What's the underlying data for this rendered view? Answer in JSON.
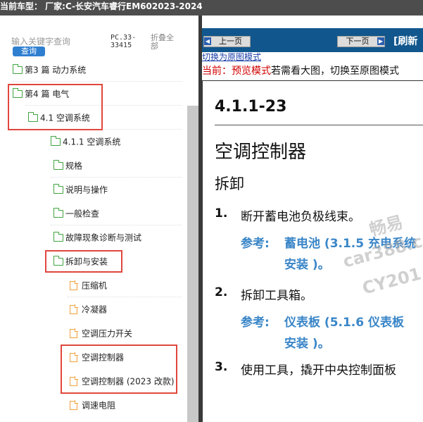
{
  "top_bar": {
    "text": "当前车型： 厂家:C-长安汽车睿行EM602023-2024"
  },
  "sidebar": {
    "search_placeholder": "输入关键字查询",
    "search_button": "查询",
    "pc_code": "PC.33-33415",
    "collapse_all": "折叠全部",
    "items": [
      {
        "label": "第3 篇 动力系统",
        "icon": "folder-icon"
      },
      {
        "label": "第4 篇 电气",
        "icon": "folder-icon"
      },
      {
        "label": "4.1 空调系统",
        "icon": "folder-icon"
      },
      {
        "label": "4.1.1 空调系统",
        "icon": "folder-icon"
      },
      {
        "label": "规格",
        "icon": "folder-icon"
      },
      {
        "label": "说明与操作",
        "icon": "folder-icon"
      },
      {
        "label": "一般检查",
        "icon": "folder-icon"
      },
      {
        "label": "故障现象诊断与测试",
        "icon": "folder-icon"
      },
      {
        "label": "拆卸与安装",
        "icon": "folder-icon"
      },
      {
        "label": "压缩机",
        "icon": "document-icon"
      },
      {
        "label": "冷凝器",
        "icon": "document-icon"
      },
      {
        "label": "空调压力开关",
        "icon": "document-icon"
      },
      {
        "label": "空调控制器",
        "icon": "document-icon"
      },
      {
        "label": "空调控制器 (2023 改款)",
        "icon": "document-icon"
      },
      {
        "label": "调速电阻",
        "icon": "document-icon"
      }
    ]
  },
  "viewer": {
    "prev_button": "上一页",
    "next_button": "下一页",
    "refresh_link": "[刷新",
    "origin_link": "切换为原图模式",
    "preview_prefix": "当前：",
    "preview_mode": "预览模式",
    "preview_hint": "若需看大图，切换至原图模式",
    "accent_color": "#11578d",
    "highlight_color": "#e0473d"
  },
  "document": {
    "section_number": "4.1.1-23",
    "title": "空调控制器",
    "subtitle": "拆卸",
    "ref_label": "参考:",
    "steps": [
      {
        "num": "1.",
        "text": "断开蓄电池负极线束。",
        "ref_line1": "蓄电池 (3.1.5 充电系统",
        "ref_line2": "安装 )。"
      },
      {
        "num": "2.",
        "text": "拆卸工具箱。",
        "ref_line1": "仪表板 (5.1.6 仪表板",
        "ref_line2": "安装 )。"
      },
      {
        "num": "3.",
        "text": "使用工具，撬开中央控制面板"
      }
    ],
    "watermarks": [
      "畅易",
      "car388.c",
      "CY201"
    ]
  }
}
